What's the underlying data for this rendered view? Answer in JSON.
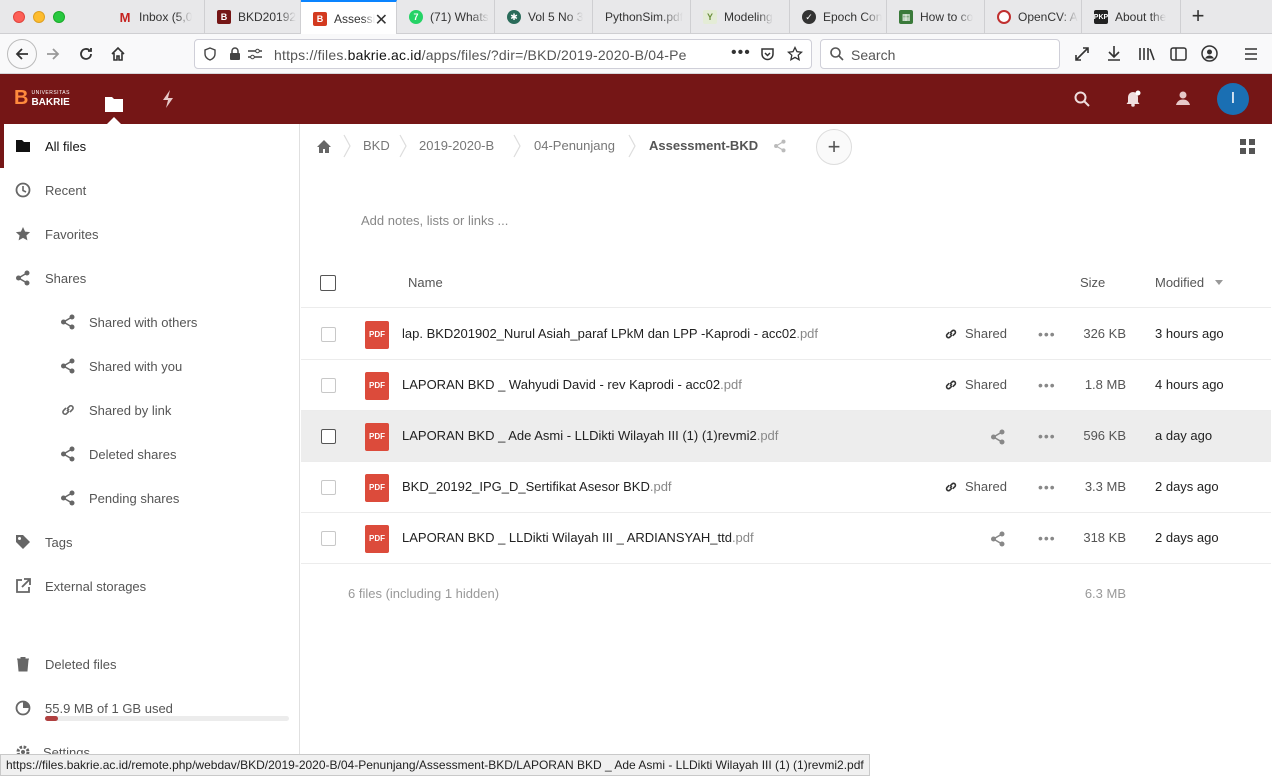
{
  "browser": {
    "tabs": [
      {
        "title": "Inbox (5,0",
        "icon": "gmail-icon",
        "color": "#c5221f"
      },
      {
        "title": "BKD20192",
        "icon": "bakrie-icon",
        "color": "#751616"
      },
      {
        "title": "Assessi",
        "icon": "bakrie-icon",
        "color": "#751616"
      },
      {
        "title": "(71) Whats",
        "icon": "whatsapp-icon",
        "color": "#25d366"
      },
      {
        "title": "Vol 5 No 3",
        "icon": "journal-icon",
        "color": "#2a6b5a"
      },
      {
        "title": "PythonSim.pdf",
        "icon": "",
        "color": ""
      },
      {
        "title": "Modeling",
        "icon": "leaf-icon",
        "color": "#6a8f3a"
      },
      {
        "title": "Epoch Con",
        "icon": "circle-icon",
        "color": "#333"
      },
      {
        "title": "How to co",
        "icon": "site-icon",
        "color": "#3a7a3a"
      },
      {
        "title": "OpenCV: A",
        "icon": "opencv-icon",
        "color": "#c03030"
      },
      {
        "title": "About the",
        "icon": "pkp-icon",
        "color": "#222"
      }
    ],
    "url_prefix": "https://files.",
    "url_domain": "bakrie.ac.id",
    "url_path": "/apps/files/?dir=/BKD/2019-2020-B/04-Pe",
    "search_placeholder": "Search",
    "status_url": "https://files.bakrie.ac.id/remote.php/webdav/BKD/2019-2020-B/04-Penunjang/Assessment-BKD/LAPORAN BKD _ Ade Asmi - LLDikti Wilayah III (1) (1)revmi2.pdf"
  },
  "header": {
    "logo_small": "UNIVERSITAS",
    "logo_big": "BAKRIE",
    "avatar_letter": "I"
  },
  "sidebar": {
    "items": [
      {
        "label": "All files",
        "icon": "folder-icon"
      },
      {
        "label": "Recent",
        "icon": "clock-icon"
      },
      {
        "label": "Favorites",
        "icon": "star-icon"
      },
      {
        "label": "Shares",
        "icon": "share-icon"
      },
      {
        "label": "Shared with others",
        "icon": "share-icon"
      },
      {
        "label": "Shared with you",
        "icon": "share-icon"
      },
      {
        "label": "Shared by link",
        "icon": "link-icon"
      },
      {
        "label": "Deleted shares",
        "icon": "share-icon"
      },
      {
        "label": "Pending shares",
        "icon": "share-icon"
      },
      {
        "label": "Tags",
        "icon": "tag-icon"
      },
      {
        "label": "External storages",
        "icon": "external-icon"
      },
      {
        "label": "Deleted files",
        "icon": "trash-icon"
      },
      {
        "label": "Settings",
        "icon": "gear-icon"
      }
    ],
    "quota_text": "55.9 MB of 1 GB used",
    "quota_fraction": 0.055
  },
  "breadcrumbs": [
    "BKD",
    "2019-2020-B",
    "04-Penunjang",
    "Assessment-BKD"
  ],
  "notes_placeholder": "Add notes, lists or links ...",
  "table": {
    "col_name": "Name",
    "col_size": "Size",
    "col_modified": "Modified",
    "files": [
      {
        "name": "lap. BKD201902_Nurul Asiah_paraf LPkM dan LPP -Kaprodi - acc02",
        "ext": ".pdf",
        "shared": "Shared",
        "size": "326 KB",
        "modified": "3 hours ago"
      },
      {
        "name": "LAPORAN BKD _ Wahyudi David - rev Kaprodi - acc02",
        "ext": ".pdf",
        "shared": "Shared",
        "size": "1.8 MB",
        "modified": "4 hours ago"
      },
      {
        "name": "LAPORAN BKD _ Ade Asmi - LLDikti Wilayah III (1) (1)revmi2",
        "ext": ".pdf",
        "shared": "",
        "size": "596 KB",
        "modified": "a day ago"
      },
      {
        "name": "BKD_20192_IPG_D_Sertifikat Asesor BKD",
        "ext": ".pdf",
        "shared": "Shared",
        "size": "3.3 MB",
        "modified": "2 days ago"
      },
      {
        "name": "LAPORAN BKD _ LLDikti Wilayah III _ ARDIANSYAH_ttd",
        "ext": ".pdf",
        "shared": "",
        "size": "318 KB",
        "modified": "2 days ago"
      }
    ],
    "pdf_badge": "PDF",
    "summary": "6 files (including 1 hidden)",
    "total_size": "6.3 MB"
  }
}
